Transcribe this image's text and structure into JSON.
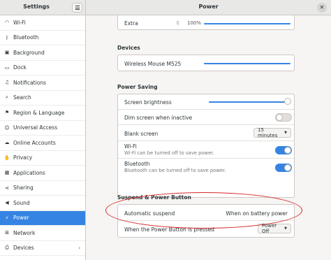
{
  "sidebar": {
    "title": "Settings",
    "items": [
      {
        "label": "Wi-Fi",
        "icon": "wifi-icon",
        "glyph": "◠",
        "chevron": false
      },
      {
        "label": "Bluetooth",
        "icon": "bluetooth-icon",
        "glyph": "ᛒ",
        "chevron": false
      },
      {
        "label": "Background",
        "icon": "background-icon",
        "glyph": "▣",
        "chevron": false
      },
      {
        "label": "Dock",
        "icon": "dock-icon",
        "glyph": "▭",
        "chevron": false
      },
      {
        "label": "Notifications",
        "icon": "bell-icon",
        "glyph": "♫",
        "chevron": false
      },
      {
        "label": "Search",
        "icon": "search-icon",
        "glyph": "⌕",
        "chevron": false
      },
      {
        "label": "Region & Language",
        "icon": "flag-icon",
        "glyph": "⚑",
        "chevron": false
      },
      {
        "label": "Universal Access",
        "icon": "accessibility-icon",
        "glyph": "☺",
        "chevron": false
      },
      {
        "label": "Online Accounts",
        "icon": "cloud-icon",
        "glyph": "☁",
        "chevron": false
      },
      {
        "label": "Privacy",
        "icon": "hand-icon",
        "glyph": "✋",
        "chevron": false
      },
      {
        "label": "Applications",
        "icon": "apps-icon",
        "glyph": "▦",
        "chevron": false
      },
      {
        "label": "Sharing",
        "icon": "share-icon",
        "glyph": "⋖",
        "chevron": false
      },
      {
        "label": "Sound",
        "icon": "speaker-icon",
        "glyph": "◀",
        "chevron": false
      },
      {
        "label": "Power",
        "icon": "power-icon",
        "glyph": "⚡",
        "chevron": false
      },
      {
        "label": "Network",
        "icon": "network-icon",
        "glyph": "⊞",
        "chevron": false
      },
      {
        "label": "Devices",
        "icon": "printer-icon",
        "glyph": "⎙",
        "chevron": true
      }
    ],
    "active": "Power"
  },
  "header": {
    "title": "Power",
    "close_glyph": "✕"
  },
  "battery": {
    "name": "Extra",
    "percent": "100%",
    "level": 1.0
  },
  "devices": {
    "title": "Devices",
    "items": [
      {
        "name": "Wireless Mouse M525",
        "level": 1.0
      }
    ]
  },
  "power_saving": {
    "title": "Power Saving",
    "screen_brightness_label": "Screen brightness",
    "screen_brightness": 1.0,
    "dim_label": "Dim screen when inactive",
    "dim_on": false,
    "blank_label": "Blank screen",
    "blank_value": "15 minutes",
    "wifi_label": "Wi-Fi",
    "wifi_sub": "Wi-Fi can be turned off to save power.",
    "wifi_on": true,
    "bluetooth_label": "Bluetooth",
    "bluetooth_sub": "Bluetooth can be turned off to save power.",
    "bluetooth_on": true
  },
  "suspend": {
    "title": "Suspend & Power Button",
    "auto_label": "Automatic suspend",
    "auto_value": "When on battery power",
    "button_label": "When the Power Button is pressed",
    "button_value": "Power Off"
  },
  "colors": {
    "accent": "#3584e4",
    "annotation": "#d62828"
  }
}
